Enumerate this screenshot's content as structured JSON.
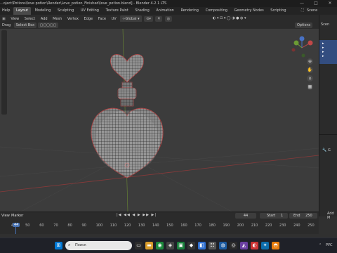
{
  "window": {
    "title": "...oject\\Potions\\love potion\\Render\\Love_potion_Finished\\love_potion.blend] - Blender 4.2.1 LTS",
    "minimize": "—",
    "maximize": "□",
    "close": "✕"
  },
  "menubar": {
    "menus": [
      "Help"
    ],
    "tabs": [
      "Layout",
      "Modeling",
      "Sculpting",
      "UV Editing",
      "Texture Paint",
      "Shading",
      "Animation",
      "Rendering",
      "Compositing",
      "Geometry Nodes",
      "Scripting"
    ],
    "active_tab": "Layout",
    "scene_label": "Scene"
  },
  "viewport_header": {
    "items": [
      "View",
      "Select",
      "Add",
      "Mesh",
      "Vertex",
      "Edge",
      "Face",
      "UV"
    ],
    "orientation": "Global",
    "options_label": "Options"
  },
  "tool_header": {
    "drag_label": "Drag",
    "select_mode": "Select Box"
  },
  "outliner": {
    "items": [
      "Scen",
      "",
      "",
      "",
      "",
      ""
    ]
  },
  "properties": {
    "add_modifier": "Add M",
    "item_label": "G"
  },
  "timeline": {
    "menu_view": "View",
    "menu_marker": "Marker",
    "current_frame": "44",
    "start_label": "Start",
    "start_value": "1",
    "end_label": "End",
    "end_value": "250",
    "ticks": [
      "40",
      "50",
      "60",
      "70",
      "80",
      "90",
      "100",
      "110",
      "120",
      "130",
      "140",
      "150",
      "160",
      "170",
      "180",
      "190",
      "200",
      "210",
      "220",
      "230",
      "240",
      "250"
    ],
    "frame_badge": "44"
  },
  "taskbar": {
    "search_placeholder": "Поиск",
    "lang": "РУС"
  },
  "colors": {
    "accent": "#4772b3",
    "wire": "#1a1a1a",
    "edge_red": "#b54848"
  }
}
